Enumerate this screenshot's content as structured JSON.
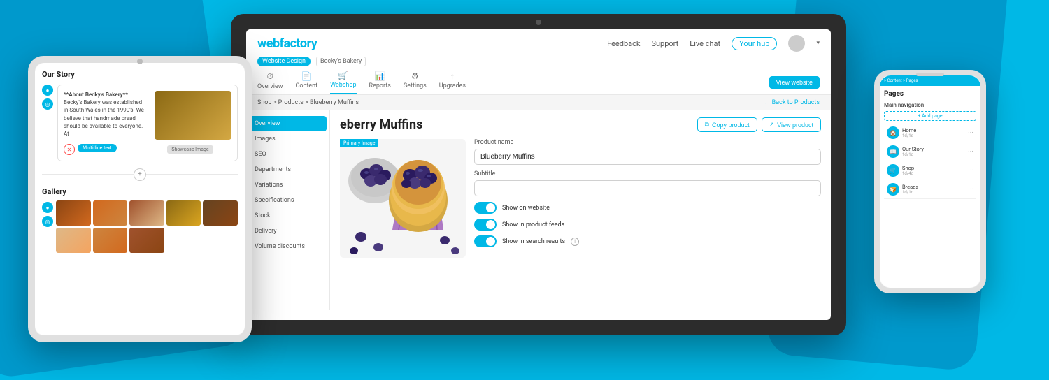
{
  "background": {
    "color": "#00b8e6"
  },
  "laptop": {
    "header": {
      "logo": "webfactory",
      "nav_items": [
        "Feedback",
        "Support",
        "Live chat"
      ],
      "your_hub": "Your hub",
      "website_design_badge": "Website Design",
      "store_name": "Becky's Bakery",
      "mainnav": [
        {
          "label": "Overview",
          "icon": "⏱",
          "active": false
        },
        {
          "label": "Content",
          "icon": "📄",
          "active": false
        },
        {
          "label": "Webshop",
          "icon": "🛒",
          "active": true
        },
        {
          "label": "Reports",
          "icon": "📊",
          "active": false
        },
        {
          "label": "Settings",
          "icon": "⚙",
          "active": false
        },
        {
          "label": "Upgrades",
          "icon": "↑",
          "active": false
        }
      ],
      "view_website": "View website"
    },
    "breadcrumb": {
      "path": "Shop > Products > Blueberry Muffins",
      "back_link": "← Back to Products"
    },
    "sidebar": {
      "items": [
        {
          "label": "Overview",
          "active": true
        },
        {
          "label": "Images",
          "active": false
        },
        {
          "label": "SEO",
          "active": false
        },
        {
          "label": "Departments",
          "active": false
        },
        {
          "label": "Variations",
          "active": false
        },
        {
          "label": "Specifications",
          "active": false
        },
        {
          "label": "Stock",
          "active": false
        },
        {
          "label": "Delivery",
          "active": false
        },
        {
          "label": "Volume discounts",
          "active": false
        }
      ]
    },
    "product": {
      "title": "eberry Muffins",
      "copy_btn": "Copy product",
      "view_btn": "View product",
      "primary_image_label": "Primary Image",
      "form": {
        "product_name_label": "Product name",
        "product_name_value": "Blueberry Muffins",
        "subtitle_label": "Subtitle",
        "subtitle_value": "",
        "toggles": [
          {
            "label": "Show on website",
            "enabled": true
          },
          {
            "label": "Show in product feeds",
            "enabled": true
          },
          {
            "label": "Show in search results",
            "enabled": true,
            "has_info": true
          }
        ]
      }
    }
  },
  "tablet": {
    "section_title": "Our Story",
    "text_content": "**About Becky's Bakery** Becky's Bakery was established in South Wales in the 1990's. We believe that handmade bread should be available to everyone. At",
    "showcase_badge": "Showcase Image",
    "multiline_badge": "Multi line text",
    "gallery_title": "Gallery",
    "gallery_items": 8
  },
  "mobile": {
    "breadcrumb": "> Content > Pages",
    "section_title": "Pages",
    "subsection": "Main navigation",
    "add_page": "+ Add page",
    "nav_items": [
      {
        "icon": "🏠",
        "label": "Home",
        "sublabel": "1d/1d"
      },
      {
        "icon": "📖",
        "label": "Our Story",
        "sublabel": "1d/1d"
      },
      {
        "icon": "🛒",
        "label": "Shop",
        "sublabel": "1d/4d"
      },
      {
        "icon": "🍞",
        "label": "Breads",
        "sublabel": "1d/1d"
      }
    ]
  }
}
